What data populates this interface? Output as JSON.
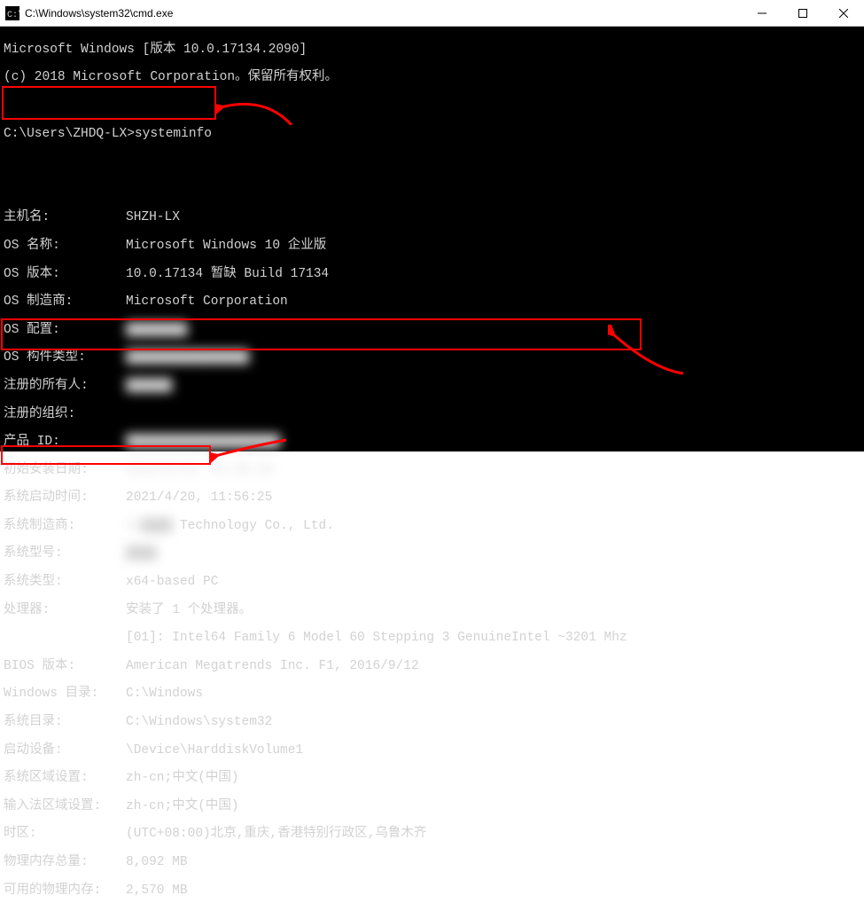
{
  "titlebar": {
    "title": "C:\\Windows\\system32\\cmd.exe"
  },
  "header": {
    "line1": "Microsoft Windows [版本 10.0.17134.2090]",
    "line2": "(c) 2018 Microsoft Corporation。保留所有权利。"
  },
  "prompt": {
    "text": "C:\\Users\\ZHDQ-LX>systeminfo"
  },
  "fields": {
    "hostname": {
      "k": "主机名:",
      "v": "SHZH-LX"
    },
    "osname": {
      "k": "OS 名称:",
      "v": "Microsoft Windows 10 企业版"
    },
    "osver": {
      "k": "OS 版本:",
      "v": "10.0.17134 暂缺 Build 17134"
    },
    "osmfr": {
      "k": "OS 制造商:",
      "v": "Microsoft Corporation"
    },
    "oscfg": {
      "k": "OS 配置:",
      "v": "████████"
    },
    "osbuild": {
      "k": "OS 构件类型:",
      "v": "████████████████"
    },
    "regowner": {
      "k": "注册的所有人:",
      "v": "██████"
    },
    "regorg": {
      "k": "注册的组织:",
      "v": ""
    },
    "prodid": {
      "k": "产品 ID:",
      "v": "████████████████████"
    },
    "install": {
      "k": "初始安装日期:",
      "v": "2019/5/13, 12:28:18"
    },
    "boot": {
      "k": "系统启动时间:",
      "v": "2021/4/20, 11:56:25"
    },
    "sysmfr": {
      "k": "系统制造商:",
      "v": "██████ Technology Co., Ltd."
    },
    "sysmodel": {
      "k": "系统型号:",
      "v": "████"
    },
    "systype": {
      "k": "系统类型:",
      "v": "x64-based PC"
    },
    "proc_hdr": {
      "k": "处理器:",
      "v": "安装了 1 个处理器。"
    },
    "proc_line": {
      "k": "",
      "v": "[01]: Intel64 Family 6 Model 60 Stepping 3 GenuineIntel ~3201 Mhz"
    },
    "bios": {
      "k": "BIOS 版本:",
      "v": "American Megatrends Inc. F1, 2016/9/12"
    },
    "windir": {
      "k": "Windows 目录:",
      "v": "C:\\Windows"
    },
    "sysdir": {
      "k": "系统目录:",
      "v": "C:\\Windows\\system32"
    },
    "bootdev": {
      "k": "启动设备:",
      "v": "\\Device\\HarddiskVolume1"
    },
    "syslocale": {
      "k": "系统区域设置:",
      "v": "zh-cn;中文(中国)"
    },
    "inlocale": {
      "k": "输入法区域设置:",
      "v": "zh-cn;中文(中国)"
    },
    "tz": {
      "k": "时区:",
      "v": "(UTC+08:00)北京,重庆,香港特别行政区,乌鲁木齐"
    },
    "physmem": {
      "k": "物理内存总量:",
      "v": "8,092 MB"
    },
    "availmem": {
      "k": "可用的物理内存:",
      "v": "2,570 MB"
    }
  }
}
